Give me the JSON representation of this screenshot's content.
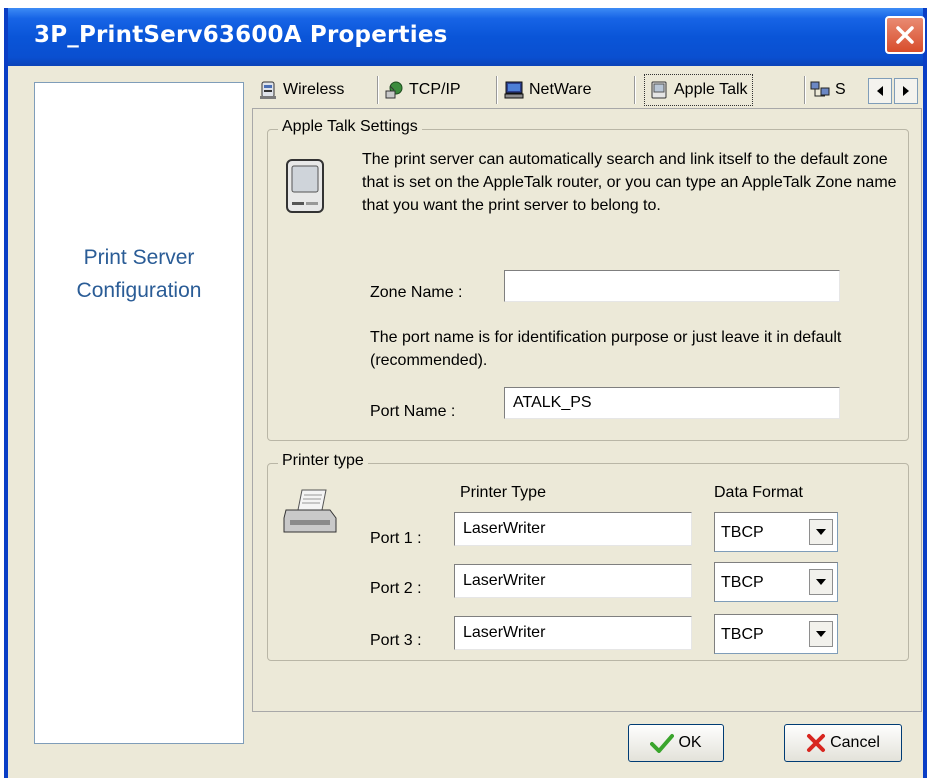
{
  "window": {
    "title": "3P_PrintServ63600A Properties"
  },
  "left_panel": {
    "title_line1": "Print Server",
    "title_line2": "Configuration"
  },
  "tabs": [
    {
      "label": "Wireless",
      "icon": "wireless-adapter-icon"
    },
    {
      "label": "TCP/IP",
      "icon": "network-globe-icon"
    },
    {
      "label": "NetWare",
      "icon": "netware-computer-icon"
    },
    {
      "label": "Apple Talk",
      "icon": "apple-computer-icon",
      "active": true
    },
    {
      "label": "S",
      "icon": "network-computers-icon"
    }
  ],
  "appletalk": {
    "legend": "Apple Talk Settings",
    "description": "The print server can automatically search and link itself to the default zone that is set on the AppleTalk router, or you can type an AppleTalk Zone name that you want the print server to belong to.",
    "zone_label": "Zone Name :",
    "zone_value": "",
    "port_desc": "The port name is for identification purpose or just leave it in default (recommended).",
    "port_label": "Port Name :",
    "port_value": "ATALK_PS"
  },
  "printer_type": {
    "legend": "Printer type",
    "col_printer_type": "Printer Type",
    "col_data_format": "Data Format",
    "ports": [
      {
        "label": "Port 1 :",
        "printer": "LaserWriter",
        "format": "TBCP"
      },
      {
        "label": "Port 2 :",
        "printer": "LaserWriter",
        "format": "TBCP"
      },
      {
        "label": "Port 3 :",
        "printer": "LaserWriter",
        "format": "TBCP"
      }
    ]
  },
  "buttons": {
    "ok": "OK",
    "cancel": "Cancel"
  },
  "colors": {
    "titlebar": "#0a55d8",
    "left_title": "#2a5c96",
    "dialog_bg": "#ece9d8"
  }
}
